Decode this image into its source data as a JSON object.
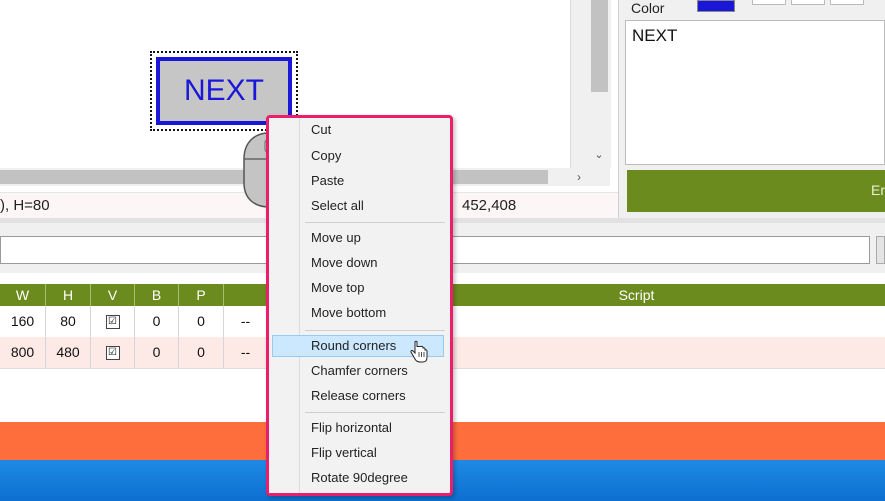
{
  "canvas": {
    "element_label": "NEXT"
  },
  "right_panel": {
    "color_label": "Color",
    "color_value": "#1a17d8",
    "text_value": "NEXT",
    "green_button_label": "Er"
  },
  "status": {
    "left_text": "), H=80",
    "right_text": "452,408"
  },
  "table": {
    "headers": [
      "W",
      "H",
      "V",
      "B",
      "P",
      "",
      "Script"
    ],
    "rows": [
      {
        "w": "160",
        "h": "80",
        "v": "☑",
        "b": "0",
        "p": "0",
        "s": "--"
      },
      {
        "w": "800",
        "h": "480",
        "v": "☑",
        "b": "0",
        "p": "0",
        "s": "--"
      }
    ]
  },
  "context_menu": {
    "items": [
      "Cut",
      "Copy",
      "Paste",
      "Select all",
      "Move up",
      "Move down",
      "Move top",
      "Move bottom",
      "Round corners",
      "Chamfer corners",
      "Release corners",
      "Flip horizontal",
      "Flip vertical",
      "Rotate 90degree"
    ],
    "highlighted": "Round corners"
  },
  "colors": {
    "accent_green": "#6b8b1f",
    "menu_border": "#ea1e6a",
    "orange_bar": "#fe6e3c",
    "taskbar_blue": "#0d6fcf"
  },
  "icons": {
    "scroll_down": "⌄",
    "scroll_right": "›"
  }
}
